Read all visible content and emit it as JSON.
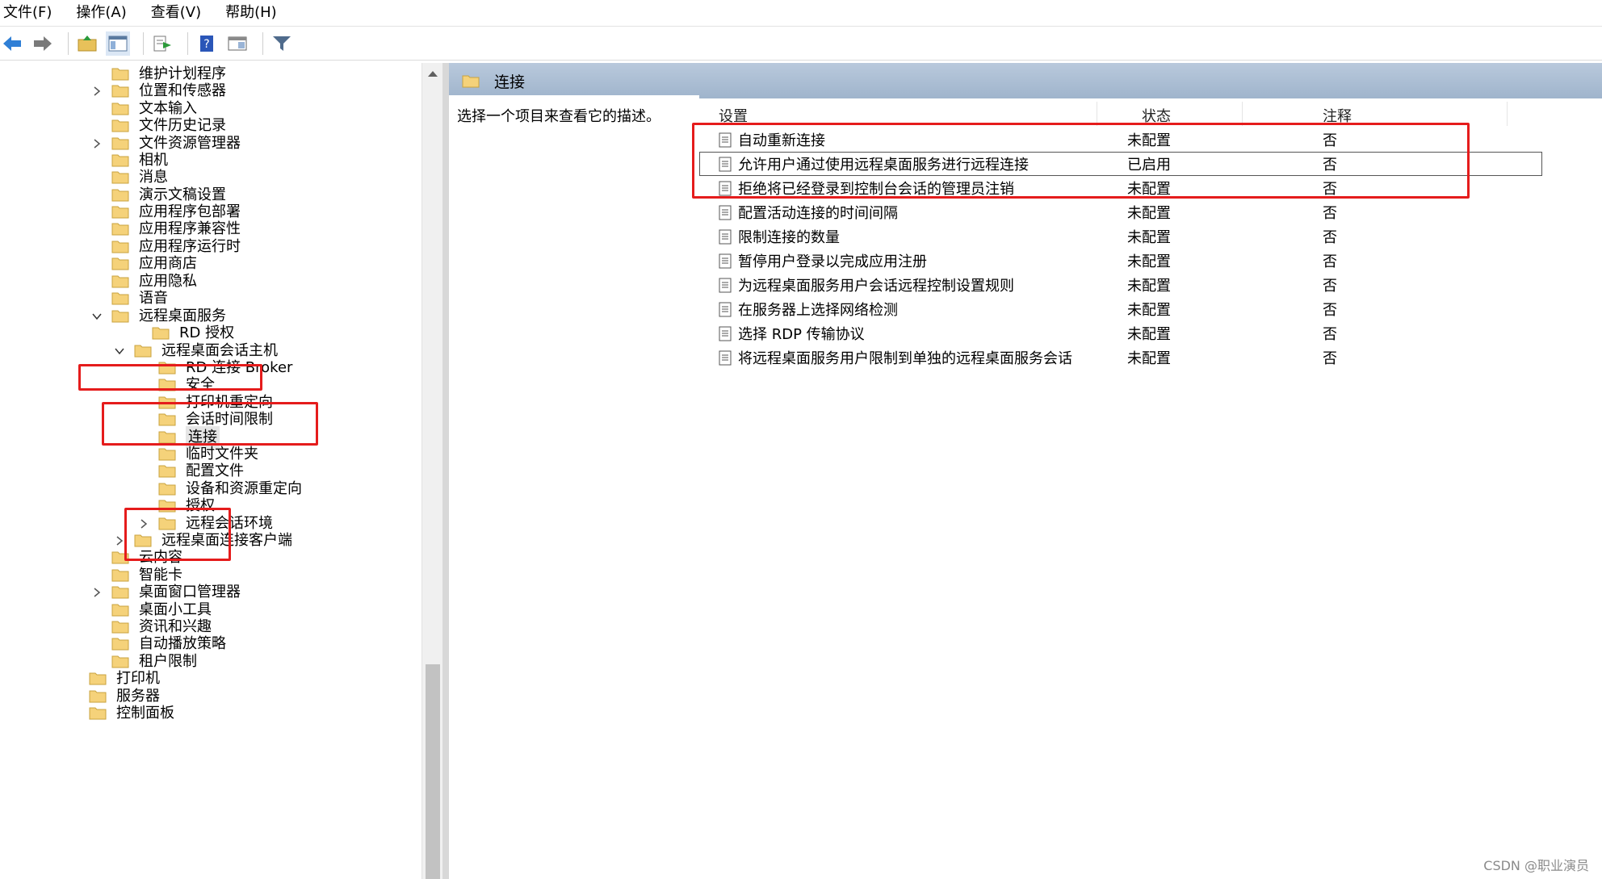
{
  "menu": [
    "文件(F)",
    "操作(A)",
    "查看(V)",
    "帮助(H)"
  ],
  "toolbar": {
    "buttons": [
      "back-icon",
      "forward-icon",
      "up-folder-icon",
      "show-hide-tree-icon",
      "export-list-icon",
      "help-icon",
      "properties-icon",
      "filter-icon"
    ]
  },
  "tree": [
    {
      "label": "维护计划程序",
      "expander": ""
    },
    {
      "label": "位置和传感器",
      "expander": ">"
    },
    {
      "label": "文本输入",
      "expander": ""
    },
    {
      "label": "文件历史记录",
      "expander": ""
    },
    {
      "label": "文件资源管理器",
      "expander": ">"
    },
    {
      "label": "相机",
      "expander": ""
    },
    {
      "label": "消息",
      "expander": ""
    },
    {
      "label": "演示文稿设置",
      "expander": ""
    },
    {
      "label": "应用程序包部署",
      "expander": ""
    },
    {
      "label": "应用程序兼容性",
      "expander": ""
    },
    {
      "label": "应用程序运行时",
      "expander": ""
    },
    {
      "label": "应用商店",
      "expander": ""
    },
    {
      "label": "应用隐私",
      "expander": ""
    },
    {
      "label": "语音",
      "expander": ""
    },
    {
      "label": "远程桌面服务",
      "expander": "v"
    },
    {
      "label": "RD 授权",
      "expander": ""
    },
    {
      "label": "远程桌面会话主机",
      "expander": "v"
    },
    {
      "label": "RD 连接 Broker",
      "expander": ""
    },
    {
      "label": "安全",
      "expander": ""
    },
    {
      "label": "打印机重定向",
      "expander": ""
    },
    {
      "label": "会话时间限制",
      "expander": ""
    },
    {
      "label": "连接",
      "expander": ""
    },
    {
      "label": "临时文件夹",
      "expander": ""
    },
    {
      "label": "配置文件",
      "expander": ""
    },
    {
      "label": "设备和资源重定向",
      "expander": ""
    },
    {
      "label": "授权",
      "expander": ""
    },
    {
      "label": "远程会话环境",
      "expander": ">"
    },
    {
      "label": "远程桌面连接客户端",
      "expander": ">"
    },
    {
      "label": "云内容",
      "expander": ""
    },
    {
      "label": "智能卡",
      "expander": ""
    },
    {
      "label": "桌面窗口管理器",
      "expander": ">"
    },
    {
      "label": "桌面小工具",
      "expander": ""
    },
    {
      "label": "资讯和兴趣",
      "expander": ""
    },
    {
      "label": "自动播放策略",
      "expander": ""
    },
    {
      "label": "租户限制",
      "expander": ""
    },
    {
      "label": "打印机",
      "expander": ""
    },
    {
      "label": "服务器",
      "expander": ""
    },
    {
      "label": "控制面板",
      "expander": ""
    }
  ],
  "right": {
    "title": "连接",
    "description": "选择一个项目来查看它的描述。",
    "columns": [
      "设置",
      "状态",
      "注释"
    ],
    "rows": [
      {
        "name": "自动重新连接",
        "state": "未配置",
        "note": "否"
      },
      {
        "name": "允许用户通过使用远程桌面服务进行远程连接",
        "state": "已启用",
        "note": "否"
      },
      {
        "name": "拒绝将已经登录到控制台会话的管理员注销",
        "state": "未配置",
        "note": "否"
      },
      {
        "name": "配置活动连接的时间间隔",
        "state": "未配置",
        "note": "否"
      },
      {
        "name": "限制连接的数量",
        "state": "未配置",
        "note": "否"
      },
      {
        "name": "暂停用户登录以完成应用注册",
        "state": "未配置",
        "note": "否"
      },
      {
        "name": "为远程桌面服务用户会话远程控制设置规则",
        "state": "未配置",
        "note": "否"
      },
      {
        "name": "在服务器上选择网络检测",
        "state": "未配置",
        "note": "否"
      },
      {
        "name": "选择 RDP 传输协议",
        "state": "未配置",
        "note": "否"
      },
      {
        "name": "将远程桌面服务用户限制到单独的远程桌面服务会话",
        "state": "未配置",
        "note": "否"
      }
    ]
  },
  "watermark": "CSDN @职业演员",
  "colors": {
    "annotation": "#e51c1c",
    "header": "#a9bcd2",
    "folder": "#f5d27a"
  }
}
